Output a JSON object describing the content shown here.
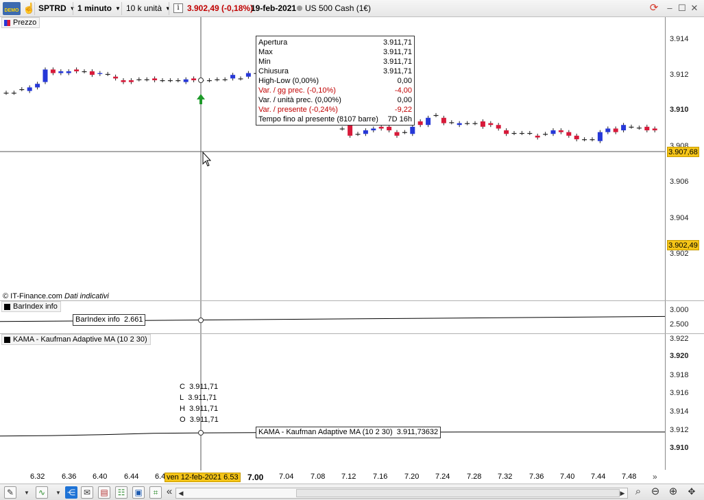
{
  "toolbar": {
    "demo_label": "DEMO",
    "instrument": "SPTRD",
    "timeframe": "1 minuto",
    "units": "10 k unità",
    "info_icon": "i",
    "quote": "3.902,49 (-0,18%)",
    "date": "19-feb-2021",
    "instrument_name": "US 500 Cash (1€)",
    "quote_color": "#c00000"
  },
  "price_pane": {
    "label": "Prezzo",
    "y_labels": [
      "3.914",
      "3.912",
      "3.910",
      "3.908",
      "3.906",
      "3.904",
      "3.902"
    ],
    "crosshair_price": "3.907,68",
    "last_price": "3.902,49",
    "copyright": "© IT-Finance.com",
    "copyright_note": "Dati indicativi"
  },
  "tooltip": {
    "rows": [
      {
        "label": "Apertura",
        "value": "3.911,71"
      },
      {
        "label": "Max",
        "value": "3.911,71"
      },
      {
        "label": "Min",
        "value": "3.911,71"
      },
      {
        "label": "Chiusura",
        "value": "3.911,71"
      },
      {
        "label": "High-Low (0,00%)",
        "value": "0,00"
      },
      {
        "label": "Var. / gg prec. (-0,10%)",
        "value": "-4,00"
      },
      {
        "label": "Var. / unità prec. (0,00%)",
        "value": "0,00"
      },
      {
        "label": "Var. / presente (-0,24%)",
        "value": "-9,22"
      },
      {
        "label": "Tempo fino al presente (8107 barre)",
        "value": "7D 16h"
      }
    ]
  },
  "barindex_pane": {
    "label": "BarIndex info",
    "info_label": "BarIndex info",
    "info_value": "2.661",
    "y_labels": [
      "3.000",
      "2.500"
    ]
  },
  "kama_pane": {
    "label": "KAMA - Kaufman Adaptive MA (10 2 30)",
    "info_label": "KAMA - Kaufman Adaptive MA (10 2 30)",
    "info_value": "3.911,73632",
    "y_labels": [
      "3.922",
      "3.920",
      "3.918",
      "3.916",
      "3.914",
      "3.912",
      "3.910"
    ],
    "ohlc": [
      {
        "k": "C",
        "v": "3.911,71"
      },
      {
        "k": "L",
        "v": "3.911,71"
      },
      {
        "k": "H",
        "v": "3.911,71"
      },
      {
        "k": "O",
        "v": "3.911,71"
      }
    ]
  },
  "x_axis": {
    "labels": [
      "6.32",
      "6.36",
      "6.40",
      "6.44",
      "6.4",
      "7.00",
      "7.04",
      "7.08",
      "7.12",
      "7.16",
      "7.20",
      "7.24",
      "7.28",
      "7.32",
      "7.36",
      "7.40",
      "7.44",
      "7.48"
    ],
    "crosshair_date": "ven 12-feb-2021 6.53",
    "more": "»"
  },
  "chart_data": {
    "type": "candlestick",
    "title": "",
    "series": [
      {
        "name": "Prezzo"
      }
    ],
    "crosshair_bar": {
      "open": 3911.71,
      "high": 3911.71,
      "low": 3911.71,
      "close": 3911.71
    },
    "ylim": [
      3901.5,
      3914.5
    ],
    "candles": [
      {
        "t": "6.30",
        "o": 3911.0,
        "c": 3911.0
      },
      {
        "t": "6.31",
        "o": 3911.0,
        "c": 3911.0
      },
      {
        "t": "6.32",
        "o": 3911.2,
        "c": 3911.2
      },
      {
        "t": "6.33",
        "o": 3911.1,
        "c": 3911.3
      },
      {
        "t": "6.34",
        "o": 3911.3,
        "c": 3911.5
      },
      {
        "t": "6.35",
        "o": 3911.6,
        "c": 3912.3
      },
      {
        "t": "6.36",
        "o": 3912.3,
        "c": 3912.1
      },
      {
        "t": "6.37",
        "o": 3912.1,
        "c": 3912.2
      },
      {
        "t": "6.38",
        "o": 3912.1,
        "c": 3912.2
      },
      {
        "t": "6.39",
        "o": 3912.3,
        "c": 3912.2
      },
      {
        "t": "6.40",
        "o": 3912.2,
        "c": 3912.2
      },
      {
        "t": "6.41",
        "o": 3912.2,
        "c": 3912.0
      },
      {
        "t": "6.42",
        "o": 3912.05,
        "c": 3912.1
      },
      {
        "t": "6.43",
        "o": 3912.05,
        "c": 3912.05
      },
      {
        "t": "6.44",
        "o": 3911.9,
        "c": 3911.8
      },
      {
        "t": "6.45",
        "o": 3911.7,
        "c": 3911.6
      },
      {
        "t": "6.46",
        "o": 3911.7,
        "c": 3911.6
      },
      {
        "t": "6.47",
        "o": 3911.75,
        "c": 3911.75
      },
      {
        "t": "6.48",
        "o": 3911.75,
        "c": 3911.75
      },
      {
        "t": "6.49",
        "o": 3911.8,
        "c": 3911.7
      },
      {
        "t": "6.50",
        "o": 3911.7,
        "c": 3911.7
      },
      {
        "t": "6.51",
        "o": 3911.7,
        "c": 3911.7
      },
      {
        "t": "6.52",
        "o": 3911.7,
        "c": 3911.7
      },
      {
        "t": "6.53",
        "o": 3911.6,
        "c": 3911.75
      },
      {
        "t": "6.54",
        "o": 3911.8,
        "c": 3911.7
      },
      {
        "t": "6.55",
        "o": 3911.7,
        "c": 3911.7
      },
      {
        "t": "6.56",
        "o": 3911.7,
        "c": 3911.7
      },
      {
        "t": "6.57",
        "o": 3911.75,
        "c": 3911.75
      },
      {
        "t": "6.58",
        "o": 3911.75,
        "c": 3911.75
      },
      {
        "t": "6.59",
        "o": 3911.8,
        "c": 3912.0
      },
      {
        "t": "7.00",
        "o": 3911.8,
        "c": 3911.8
      },
      {
        "t": "7.01",
        "o": 3911.9,
        "c": 3912.1
      },
      {
        "t": "7.02",
        "o": 3912.1,
        "c": 3912.1
      },
      {
        "t": "7.03",
        "o": 3912.2,
        "c": 3912.1
      },
      {
        "t": "7.04",
        "o": 3912.0,
        "c": 3912.0
      },
      {
        "t": "7.05",
        "o": 3912.0,
        "c": 3912.0
      },
      {
        "t": "7.06",
        "o": 3911.6,
        "c": 3911.6
      },
      {
        "t": "7.07",
        "o": 3911.4,
        "c": 3911.4
      },
      {
        "t": "7.08",
        "o": 3911.0,
        "c": 3911.0
      },
      {
        "t": "7.09",
        "o": 3910.6,
        "c": 3910.6
      },
      {
        "t": "7.10",
        "o": 3910.2,
        "c": 3910.2
      },
      {
        "t": "7.11",
        "o": 3909.8,
        "c": 3909.8
      },
      {
        "t": "7.12",
        "o": 3909.4,
        "c": 3909.4
      },
      {
        "t": "7.13",
        "o": 3909.0,
        "c": 3909.0
      },
      {
        "t": "7.14",
        "o": 3909.2,
        "c": 3908.6
      },
      {
        "t": "7.15",
        "o": 3908.7,
        "c": 3908.7
      },
      {
        "t": "7.16",
        "o": 3908.7,
        "c": 3908.9
      },
      {
        "t": "7.17",
        "o": 3908.9,
        "c": 3909.0
      },
      {
        "t": "7.18",
        "o": 3909.1,
        "c": 3909.0
      },
      {
        "t": "7.19",
        "o": 3909.1,
        "c": 3908.9
      },
      {
        "t": "7.20",
        "o": 3908.8,
        "c": 3908.6
      },
      {
        "t": "7.21",
        "o": 3908.8,
        "c": 3908.8
      },
      {
        "t": "7.22",
        "o": 3908.7,
        "c": 3909.1
      },
      {
        "t": "7.23",
        "o": 3909.4,
        "c": 3909.2
      },
      {
        "t": "7.24",
        "o": 3909.2,
        "c": 3909.6
      },
      {
        "t": "7.25",
        "o": 3909.75,
        "c": 3909.75
      },
      {
        "t": "7.26",
        "o": 3909.6,
        "c": 3909.3
      },
      {
        "t": "7.27",
        "o": 3909.35,
        "c": 3909.35
      },
      {
        "t": "7.28",
        "o": 3909.2,
        "c": 3909.3
      },
      {
        "t": "7.29",
        "o": 3909.3,
        "c": 3909.3
      },
      {
        "t": "7.30",
        "o": 3909.3,
        "c": 3909.3
      },
      {
        "t": "7.31",
        "o": 3909.4,
        "c": 3909.1
      },
      {
        "t": "7.32",
        "o": 3909.3,
        "c": 3909.2
      },
      {
        "t": "7.33",
        "o": 3909.2,
        "c": 3909.0
      },
      {
        "t": "7.34",
        "o": 3908.9,
        "c": 3908.7
      },
      {
        "t": "7.35",
        "o": 3908.75,
        "c": 3908.75
      },
      {
        "t": "7.36",
        "o": 3908.75,
        "c": 3908.75
      },
      {
        "t": "7.37",
        "o": 3908.75,
        "c": 3908.75
      },
      {
        "t": "7.38",
        "o": 3908.6,
        "c": 3908.5
      },
      {
        "t": "7.39",
        "o": 3908.7,
        "c": 3908.7
      },
      {
        "t": "7.40",
        "o": 3908.7,
        "c": 3908.9
      },
      {
        "t": "7.41",
        "o": 3908.9,
        "c": 3908.8
      },
      {
        "t": "7.42",
        "o": 3908.8,
        "c": 3908.6
      },
      {
        "t": "7.43",
        "o": 3908.6,
        "c": 3908.4
      },
      {
        "t": "7.44",
        "o": 3908.4,
        "c": 3908.4
      },
      {
        "t": "7.45",
        "o": 3908.4,
        "c": 3908.4
      },
      {
        "t": "7.46",
        "o": 3908.3,
        "c": 3908.8
      },
      {
        "t": "7.47",
        "o": 3908.8,
        "c": 3909.0
      },
      {
        "t": "7.48",
        "o": 3909.0,
        "c": 3908.8
      },
      {
        "t": "7.49",
        "o": 3908.9,
        "c": 3909.2
      },
      {
        "t": "7.50",
        "o": 3909.1,
        "c": 3909.1
      },
      {
        "t": "7.51",
        "o": 3909.05,
        "c": 3909.05
      },
      {
        "t": "7.52",
        "o": 3909.1,
        "c": 3908.9
      },
      {
        "t": "7.53",
        "o": 3909.0,
        "c": 3908.9
      }
    ],
    "barindex_ylim": [
      2300,
      3100
    ],
    "barindex_start": 2600,
    "barindex_end": 2775,
    "kama_ylim": [
      3909.0,
      3922.6
    ],
    "kama_values": [
      3911.3,
      3911.35,
      3911.45,
      3911.6,
      3911.65,
      3911.68,
      3911.7,
      3911.72,
      3911.73,
      3911.74,
      3911.74,
      3911.74,
      3911.74,
      3911.74
    ]
  },
  "bottom": {
    "scroll_left": "◀",
    "scroll_right": "▶",
    "collapse": "«"
  }
}
